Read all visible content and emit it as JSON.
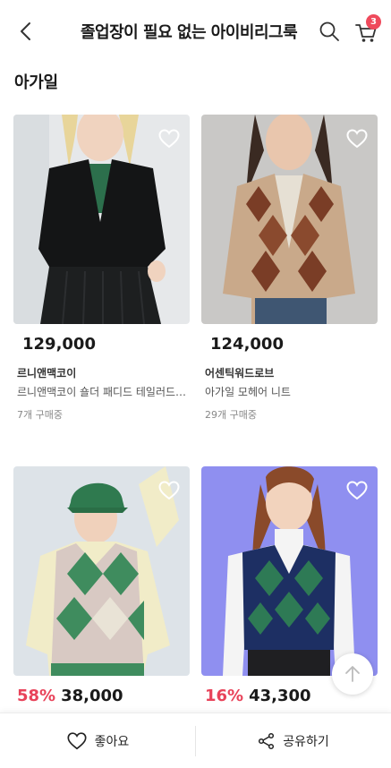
{
  "header": {
    "title": "졸업장이 필요 없는 아이비리그룩",
    "cart_count": "3"
  },
  "section": {
    "title": "아가일"
  },
  "products": [
    {
      "price": "129,000",
      "discount": "",
      "brand": "르니앤맥코이",
      "name": "르니앤맥코이 숄더 패디드 테일러드 자켓",
      "buyers": "7개 구매중"
    },
    {
      "price": "124,000",
      "discount": "",
      "brand": "어센틱워드로브",
      "name": "아가일 모헤어 니트",
      "buyers": "29개 구매중"
    },
    {
      "price": "38,000",
      "discount": "58%",
      "brand": "",
      "name": "",
      "buyers": ""
    },
    {
      "price": "43,300",
      "discount": "16%",
      "brand": "",
      "name": "",
      "buyers": ""
    }
  ],
  "bottom_bar": {
    "like_label": "좋아요",
    "share_label": "공유하기"
  },
  "colors": {
    "accent": "#e8435a",
    "badge": "#ef4a5c"
  },
  "icons": [
    "back-icon",
    "search-icon",
    "cart-icon",
    "heart-icon",
    "arrow-up-icon",
    "share-icon"
  ]
}
